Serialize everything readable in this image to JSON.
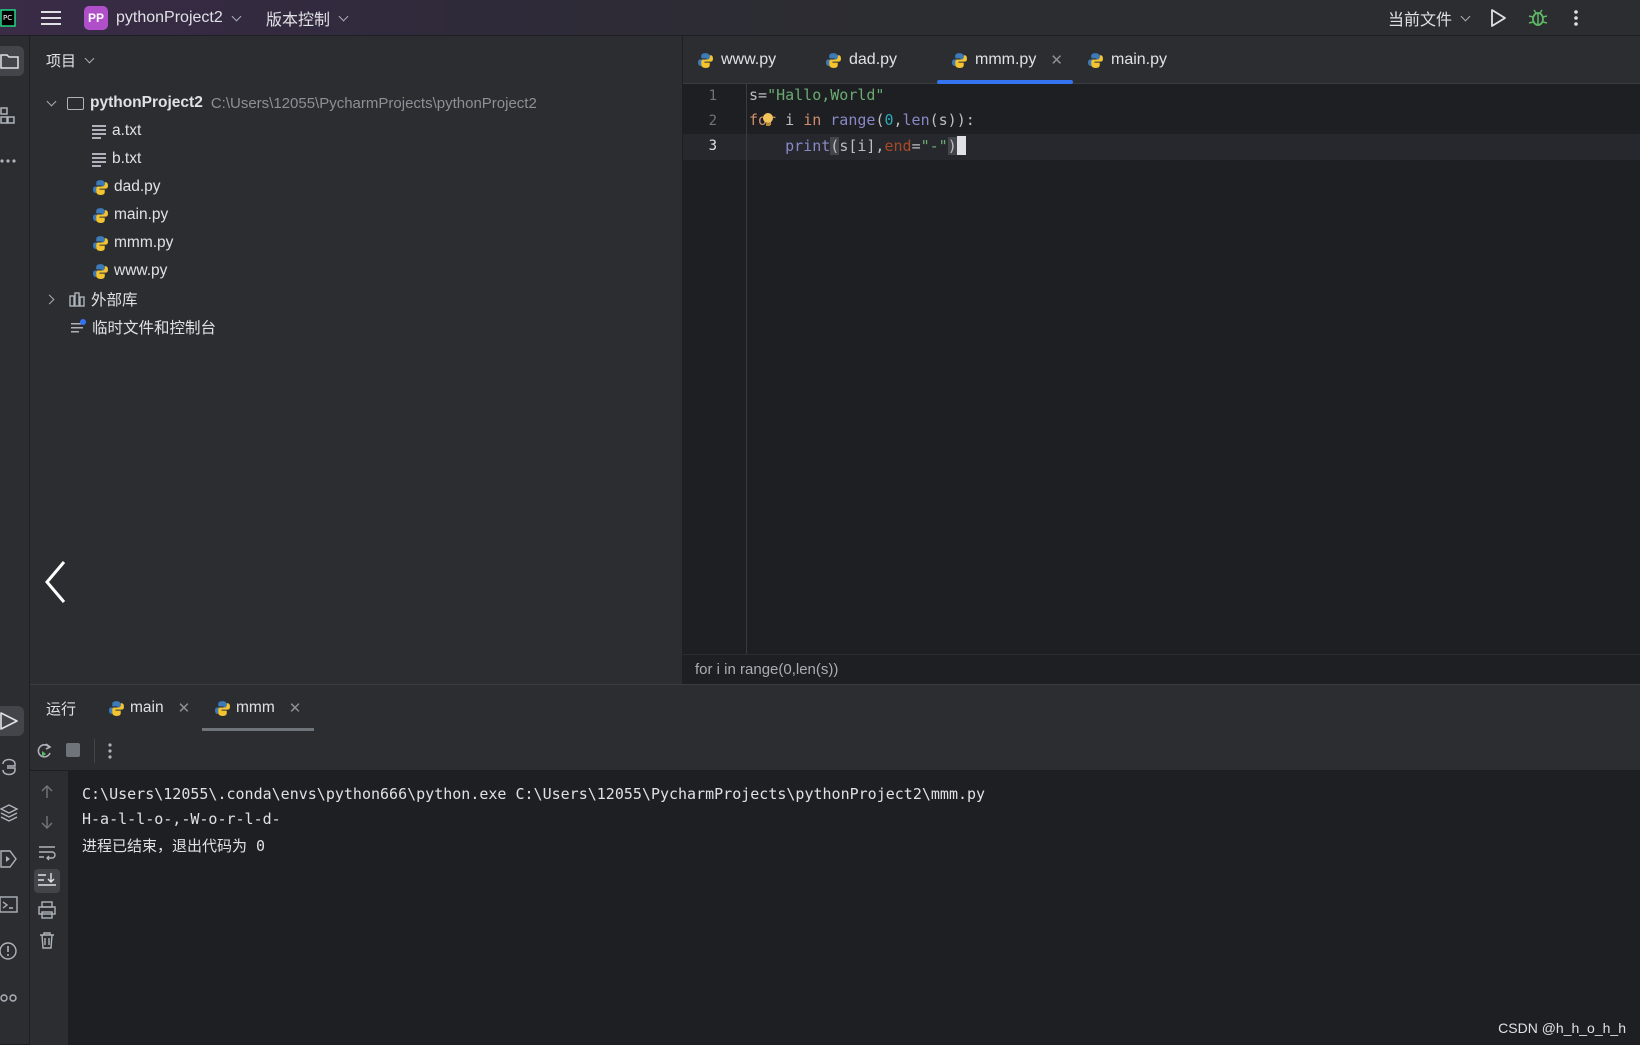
{
  "titlebar": {
    "project_badge": "PP",
    "project_name": "pythonProject2",
    "vcs_menu": "版本控制",
    "run_config": "当前文件"
  },
  "project_panel": {
    "header": "项目",
    "root_name": "pythonProject2",
    "root_path": "C:\\Users\\12055\\PycharmProjects\\pythonProject2",
    "files": [
      "a.txt",
      "b.txt",
      "dad.py",
      "main.py",
      "mmm.py",
      "www.py"
    ],
    "external_libs": "外部库",
    "scratches": "临时文件和控制台"
  },
  "editor": {
    "tabs": [
      {
        "label": "www.py"
      },
      {
        "label": "dad.py"
      },
      {
        "label": "mmm.py"
      },
      {
        "label": "main.py"
      }
    ],
    "line_numbers": [
      "1",
      "2",
      "3"
    ],
    "breadcrumb": "for i in range(0,len(s))"
  },
  "run_panel": {
    "title": "运行",
    "tabs": [
      {
        "label": "main"
      },
      {
        "label": "mmm"
      }
    ],
    "output": [
      "C:\\Users\\12055\\.conda\\envs\\python666\\python.exe C:\\Users\\12055\\PycharmProjects\\pythonProject2\\mmm.py",
      "H-a-l-l-o-,-W-o-r-l-d-",
      "进程已结束，退出代码为 0"
    ]
  },
  "watermark": "CSDN @h_h_o_h_h",
  "colors": {
    "accent": "#3574f0",
    "badge": "#b04fc9",
    "string": "#6aab73",
    "keyword": "#cf8e6d",
    "number": "#2aacb8",
    "builtin": "#8888c6",
    "param": "#aa4926",
    "run_green": "#5fb865"
  }
}
